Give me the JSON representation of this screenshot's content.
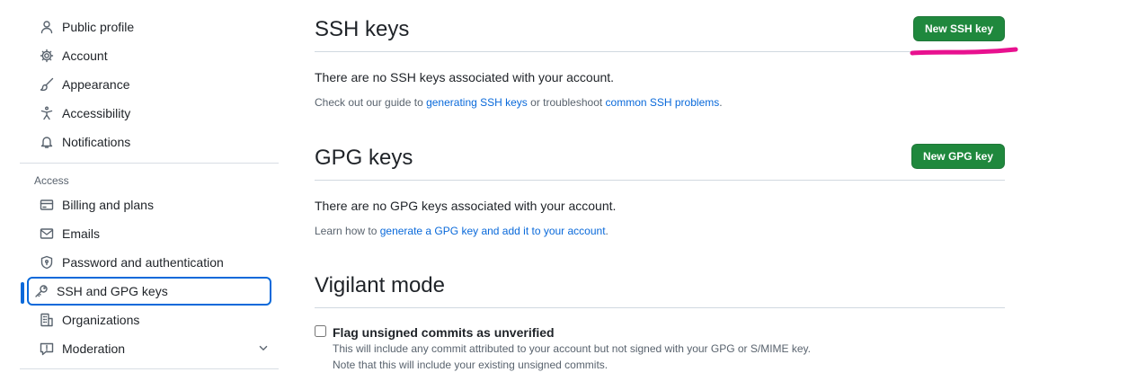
{
  "sidebar": {
    "items_top": [
      {
        "label": "Public profile",
        "icon": "person-icon"
      },
      {
        "label": "Account",
        "icon": "gear-icon"
      },
      {
        "label": "Appearance",
        "icon": "paintbrush-icon"
      },
      {
        "label": "Accessibility",
        "icon": "accessibility-icon"
      },
      {
        "label": "Notifications",
        "icon": "bell-icon"
      }
    ],
    "access_heading": "Access",
    "items_access": [
      {
        "label": "Billing and plans",
        "icon": "credit-card-icon"
      },
      {
        "label": "Emails",
        "icon": "mail-icon"
      },
      {
        "label": "Password and authentication",
        "icon": "shield-lock-icon"
      },
      {
        "label": "SSH and GPG keys",
        "icon": "key-icon",
        "active": true
      },
      {
        "label": "Organizations",
        "icon": "organization-icon"
      },
      {
        "label": "Moderation",
        "icon": "report-icon",
        "expandable": true
      }
    ]
  },
  "ssh": {
    "title": "SSH keys",
    "button": "New SSH key",
    "empty": "There are no SSH keys associated with your account.",
    "help_prefix": "Check out our guide to ",
    "help_link1": "generating SSH keys",
    "help_middle": " or troubleshoot ",
    "help_link2": "common SSH problems",
    "help_suffix": "."
  },
  "gpg": {
    "title": "GPG keys",
    "button": "New GPG key",
    "empty": "There are no GPG keys associated with your account.",
    "help_prefix": "Learn how to ",
    "help_link": "generate a GPG key and add it to your account",
    "help_suffix": "."
  },
  "vigilant": {
    "title": "Vigilant mode",
    "checkbox_label": "Flag unsigned commits as unverified",
    "checkbox_checked": false,
    "note1": "This will include any commit attributed to your account but not signed with your GPG or S/MIME key.",
    "note2": "Note that this will include your existing unsigned commits."
  },
  "colors": {
    "accent": "#0969da",
    "button_green": "#1f883d",
    "annotation_magenta": "#e8118f"
  }
}
